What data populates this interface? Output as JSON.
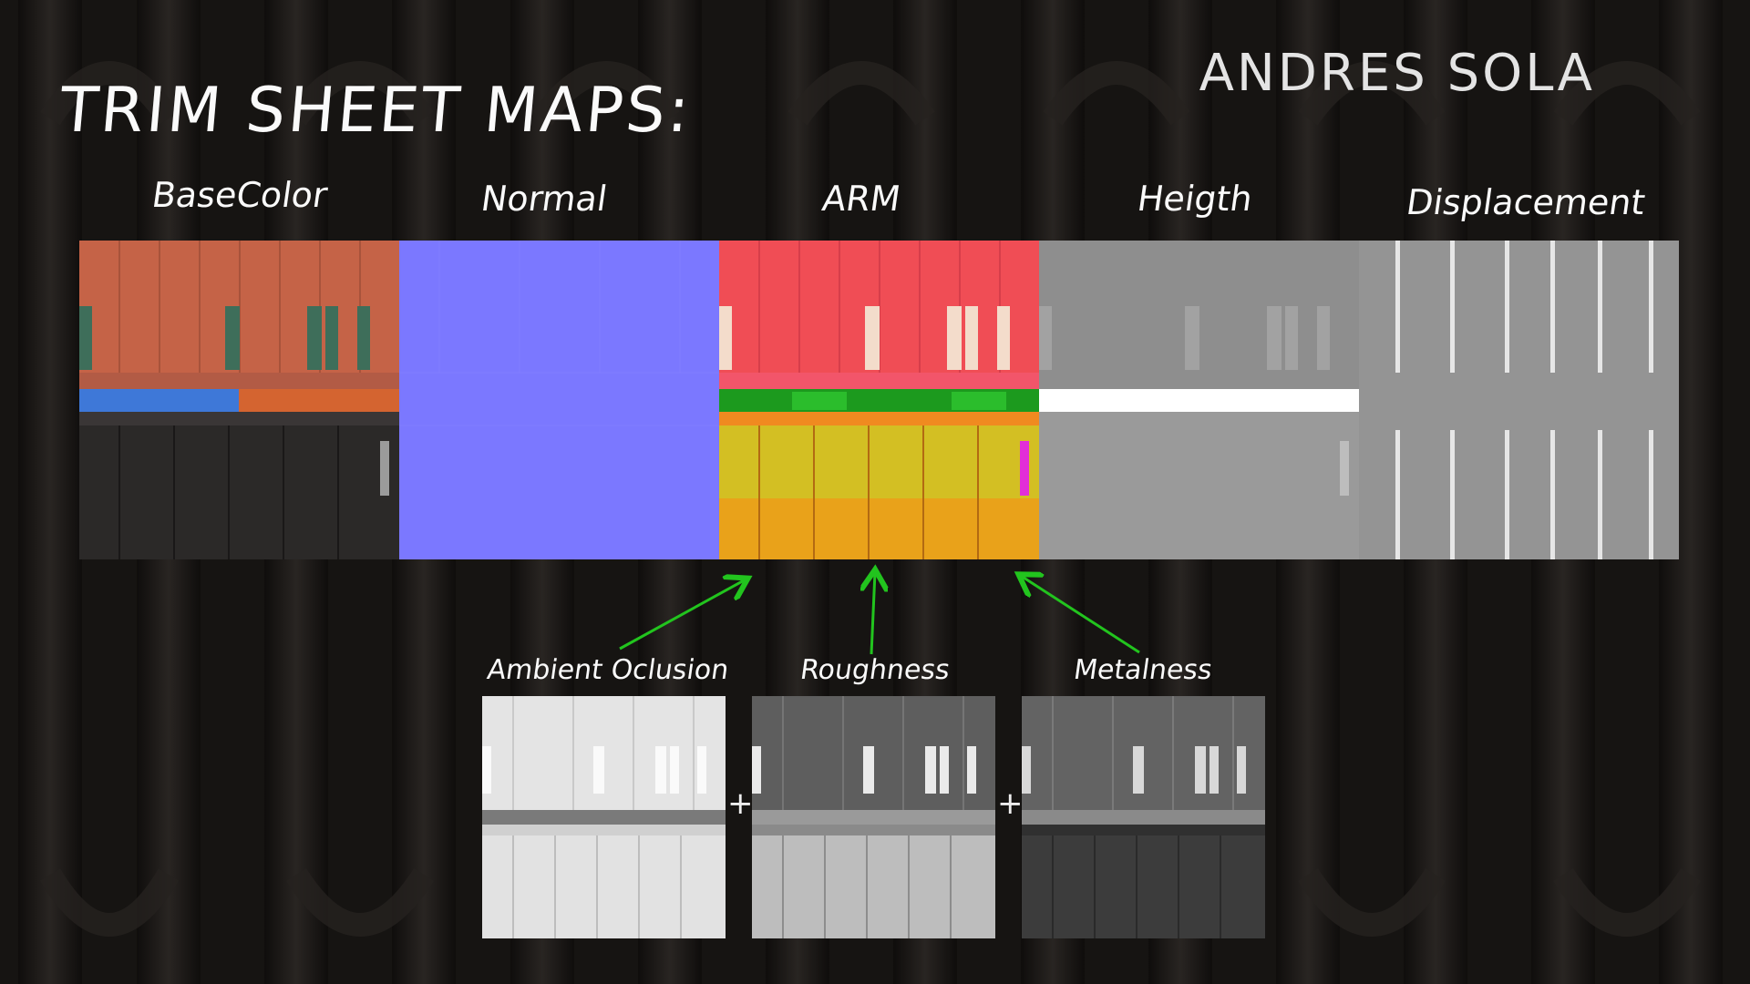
{
  "title": "TRIM SHEET MAPS:",
  "author": "ANDRES SOLA",
  "maps": [
    {
      "label": "BaseColor"
    },
    {
      "label": "Normal"
    },
    {
      "label": "ARM"
    },
    {
      "label": "Heigth"
    },
    {
      "label": "Displacement"
    }
  ],
  "sub_maps": [
    {
      "label": "Ambient Oclusion"
    },
    {
      "label": "Roughness"
    },
    {
      "label": "Metalness"
    }
  ],
  "plus_symbol": "+",
  "colors": {
    "background": "#151311",
    "arrow": "#22c41e",
    "normal": "#7b78ff",
    "arm_top": "#f04d55",
    "basecolor_top": "#c56347"
  }
}
